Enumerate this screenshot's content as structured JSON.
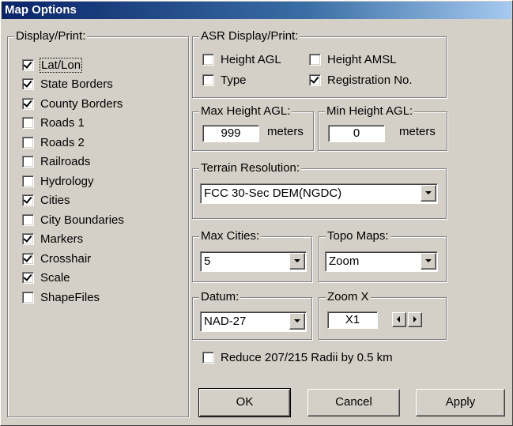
{
  "window": {
    "title": "Map Options"
  },
  "display_print": {
    "legend": "Display/Print:",
    "items": [
      {
        "label": "Lat/Lon",
        "checked": true
      },
      {
        "label": "State Borders",
        "checked": true
      },
      {
        "label": "County Borders",
        "checked": true
      },
      {
        "label": "Roads 1",
        "checked": false
      },
      {
        "label": "Roads 2",
        "checked": false
      },
      {
        "label": "Railroads",
        "checked": false
      },
      {
        "label": "Hydrology",
        "checked": false
      },
      {
        "label": "Cities",
        "checked": true
      },
      {
        "label": "City Boundaries",
        "checked": false
      },
      {
        "label": "Markers",
        "checked": true
      },
      {
        "label": "Crosshair",
        "checked": true
      },
      {
        "label": "Scale",
        "checked": true
      },
      {
        "label": "ShapeFiles",
        "checked": false
      }
    ]
  },
  "asr": {
    "legend": "ASR Display/Print:",
    "height_agl": {
      "label": "Height AGL",
      "checked": false
    },
    "height_amsl": {
      "label": "Height AMSL",
      "checked": false
    },
    "type": {
      "label": "Type",
      "checked": false
    },
    "registration": {
      "label": "Registration No.",
      "checked": true
    }
  },
  "max_height": {
    "legend": "Max Height AGL:",
    "value": "999",
    "unit": "meters"
  },
  "min_height": {
    "legend": "Min Height AGL:",
    "value": "0",
    "unit": "meters"
  },
  "terrain": {
    "legend": "Terrain Resolution:",
    "value": "FCC 30-Sec DEM(NGDC)"
  },
  "max_cities": {
    "legend": "Max Cities:",
    "value": "5"
  },
  "topo_maps": {
    "legend": "Topo Maps:",
    "value": "Zoom"
  },
  "datum": {
    "legend": "Datum:",
    "value": "NAD-27"
  },
  "zoom": {
    "legend": "Zoom X",
    "value": "X1"
  },
  "reduce": {
    "label": "Reduce 207/215 Radii by 0.5 km",
    "checked": false
  },
  "buttons": {
    "ok": "OK",
    "cancel": "Cancel",
    "apply": "Apply"
  }
}
